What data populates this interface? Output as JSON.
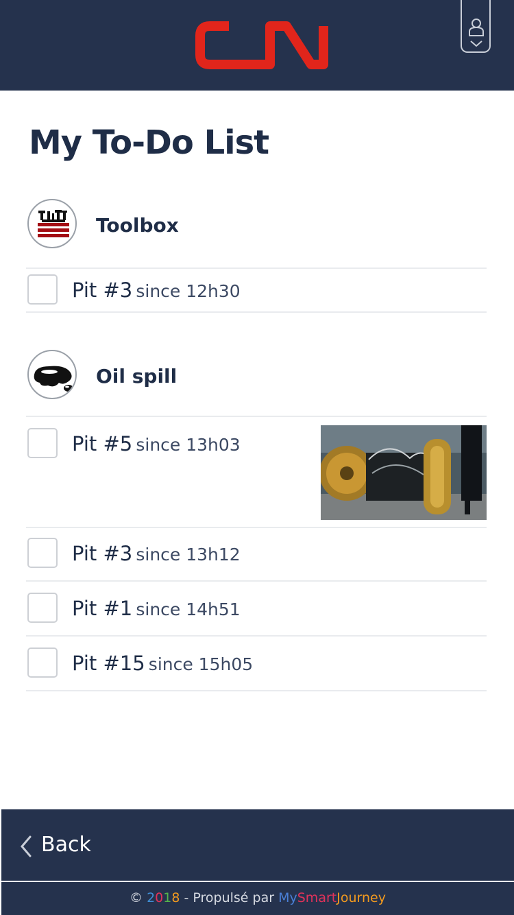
{
  "header": {
    "logo_text": "CN",
    "brand_color": "#e1251b",
    "background": "#25324d",
    "user_icon": "user-icon",
    "dropdown_icon": "chevron-down-icon"
  },
  "page": {
    "title": "My To-Do List"
  },
  "sections": [
    {
      "title": "Toolbox",
      "icon": "toolbox-icon",
      "items": [
        {
          "pit": "Pit #3",
          "since": "since 12h30"
        }
      ]
    },
    {
      "title": "Oil spill",
      "icon": "oil-spill-icon",
      "items": [
        {
          "pit": "Pit #5",
          "since": "since 13h03",
          "photo": "locomotive-wheelset-photo"
        },
        {
          "pit": "Pit #3",
          "since": "since 13h12"
        },
        {
          "pit": "Pit #1",
          "since": "since 14h51"
        },
        {
          "pit": "Pit #15",
          "since": "since 15h05"
        }
      ]
    }
  ],
  "footer": {
    "back_label": "Back",
    "back_icon": "chevron-left-icon",
    "copyright": {
      "symbol": "©",
      "year_digits": [
        "2",
        "0",
        "1",
        "8"
      ],
      "powered": " - Propulsé par ",
      "brand_parts": [
        "My",
        "Smart",
        "Journey"
      ]
    }
  }
}
